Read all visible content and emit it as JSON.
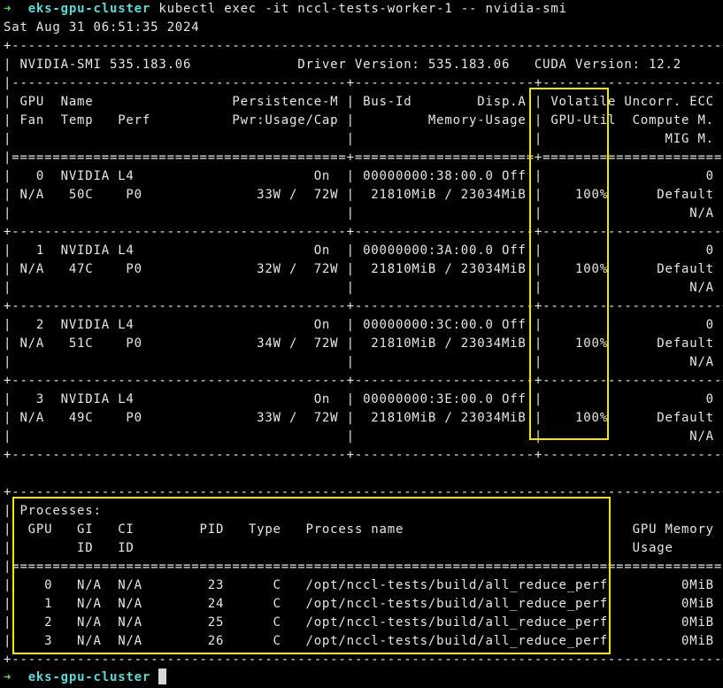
{
  "prompt": {
    "arrow": "➜",
    "cluster": "eks-gpu-cluster",
    "command": "kubectl exec -it nccl-tests-worker-1 -- nvidia-smi"
  },
  "timestamp": "Sat Aug 31 06:51:35 2024",
  "output_lines": [
    "+---------------------------------------------------------------------------------------+",
    "| NVIDIA-SMI 535.183.06             Driver Version: 535.183.06   CUDA Version: 12.2     |",
    "|-----------------------------------------+----------------------+----------------------+",
    "| GPU  Name                 Persistence-M | Bus-Id        Disp.A | Volatile Uncorr. ECC |",
    "| Fan  Temp   Perf          Pwr:Usage/Cap |         Memory-Usage | GPU-Util  Compute M. |",
    "|                                         |                      |               MIG M. |",
    "|=========================================+======================+======================|",
    "|   0  NVIDIA L4                      On  | 00000000:38:00.0 Off |                    0 |",
    "| N/A   50C    P0              33W /  72W |  21810MiB / 23034MiB |    100%      Default |",
    "|                                         |                      |                  N/A |",
    "+-----------------------------------------+----------------------+----------------------+",
    "|   1  NVIDIA L4                      On  | 00000000:3A:00.0 Off |                    0 |",
    "| N/A   47C    P0              32W /  72W |  21810MiB / 23034MiB |    100%      Default |",
    "|                                         |                      |                  N/A |",
    "+-----------------------------------------+----------------------+----------------------+",
    "|   2  NVIDIA L4                      On  | 00000000:3C:00.0 Off |                    0 |",
    "| N/A   51C    P0              34W /  72W |  21810MiB / 23034MiB |    100%      Default |",
    "|                                         |                      |                  N/A |",
    "+-----------------------------------------+----------------------+----------------------+",
    "|   3  NVIDIA L4                      On  | 00000000:3E:00.0 Off |                    0 |",
    "| N/A   49C    P0              33W /  72W |  21810MiB / 23034MiB |    100%      Default |",
    "|                                         |                      |                  N/A |",
    "+-----------------------------------------+----------------------+----------------------+",
    "",
    "+---------------------------------------------------------------------------------------+",
    "| Processes:                                                                            |",
    "|  GPU   GI   CI        PID   Type   Process name                            GPU Memory |",
    "|        ID   ID                                                             Usage      |",
    "|=======================================================================================|",
    "|    0   N/A  N/A        23      C   /opt/nccl-tests/build/all_reduce_perf         0MiB |",
    "|    1   N/A  N/A        24      C   /opt/nccl-tests/build/all_reduce_perf         0MiB |",
    "|    2   N/A  N/A        25      C   /opt/nccl-tests/build/all_reduce_perf         0MiB |",
    "|    3   N/A  N/A        26      C   /opt/nccl-tests/build/all_reduce_perf         0MiB |",
    "+---------------------------------------------------------------------------------------+"
  ],
  "final_prompt": {
    "arrow": "➜",
    "cluster": "eks-gpu-cluster"
  },
  "colors": {
    "background": "#000000",
    "text": "#e6e6e6",
    "prompt_arrow": "#5fd75f",
    "cluster_name": "#5fd7d7",
    "highlight": "#f2e600"
  }
}
